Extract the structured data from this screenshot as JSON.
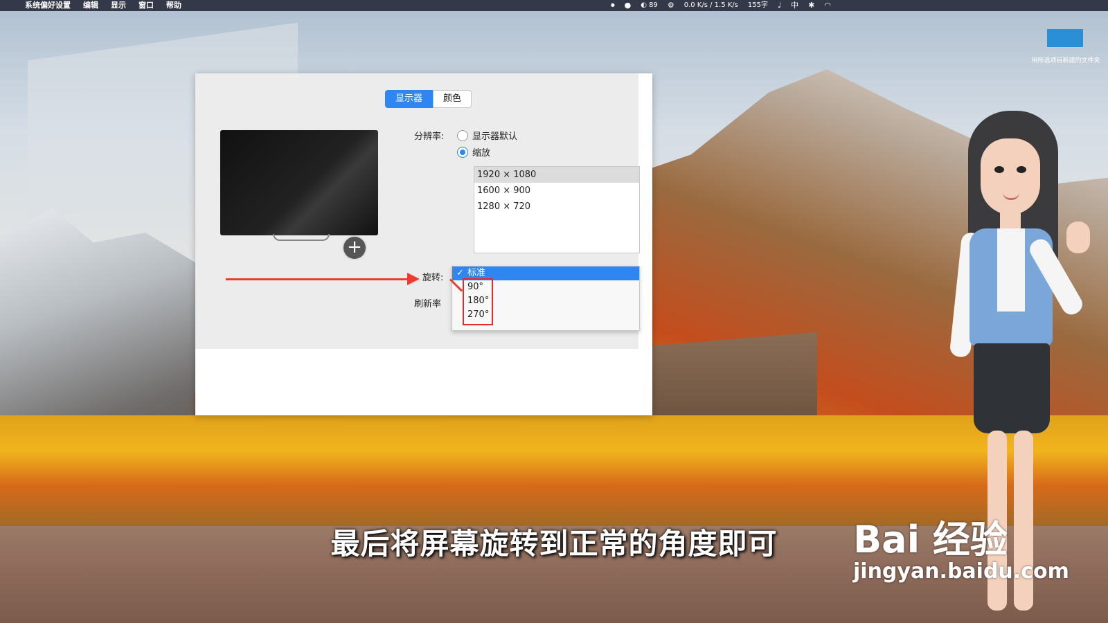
{
  "menubar": {
    "apple_icon": "apple-icon",
    "items": [
      "系统偏好设置",
      "编辑",
      "显示",
      "窗口",
      "帮助"
    ],
    "battery_percent": "89",
    "network_up": "0.0 K/s",
    "network_down": "1.5 K/s",
    "word_count": "155字",
    "input_method": "中"
  },
  "desktop": {
    "folder_label": "用所选项目新建的文件夹"
  },
  "prefs": {
    "tabs": [
      "显示器",
      "颜色"
    ],
    "resolution_label": "分辨率:",
    "option_default": "显示器默认",
    "option_scaled": "缩放",
    "resolutions": [
      "1920 × 1080",
      "1600 × 900",
      "1280 × 720"
    ],
    "rotation_label": "旋转:",
    "refresh_label": "刷新率",
    "rotation_options": [
      "标准",
      "90°",
      "180°",
      "270°"
    ],
    "add_symbol": "+"
  },
  "video": {
    "subtitle": "最后将屏幕旋转到正常的角度即可",
    "logo_main": "Bai 经验",
    "logo_sub": "jingyan.baidu.com"
  },
  "colors": {
    "accent_blue": "#2f86f0",
    "annotation_red": "#ec3b30"
  }
}
